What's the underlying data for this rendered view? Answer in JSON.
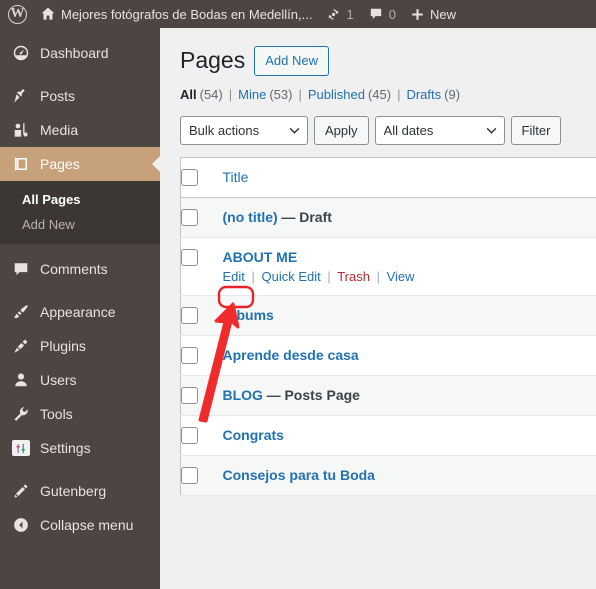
{
  "adminbar": {
    "wp_logo": "wordpress-logo-icon",
    "site_icon": "home-icon",
    "site_name": "Mejores fotógrafos de Bodas en Medellín,...",
    "updates_icon": "updates-icon",
    "updates_count": "1",
    "comments_icon": "comment-bubble-icon",
    "comments_count": "0",
    "new_icon": "plus-icon",
    "new_label": "New"
  },
  "sidebar": {
    "items": [
      {
        "label": "Dashboard",
        "icon": "dashboard-icon",
        "name": "dashboard"
      },
      {
        "label": "Posts",
        "icon": "pin-icon",
        "name": "posts"
      },
      {
        "label": "Media",
        "icon": "media-icon",
        "name": "media"
      },
      {
        "label": "Pages",
        "icon": "pages-icon",
        "name": "pages"
      },
      {
        "label": "Comments",
        "icon": "comment-bubble-icon",
        "name": "comments"
      },
      {
        "label": "Appearance",
        "icon": "paintbrush-icon",
        "name": "appearance"
      },
      {
        "label": "Plugins",
        "icon": "plug-icon",
        "name": "plugins"
      },
      {
        "label": "Users",
        "icon": "user-icon",
        "name": "users"
      },
      {
        "label": "Tools",
        "icon": "wrench-icon",
        "name": "tools"
      },
      {
        "label": "Settings",
        "icon": "sliders-icon",
        "name": "settings"
      },
      {
        "label": "Gutenberg",
        "icon": "pencil-icon",
        "name": "gutenberg"
      },
      {
        "label": "Collapse menu",
        "icon": "collapse-arrow-icon",
        "name": "collapse-menu"
      }
    ],
    "submenu": [
      {
        "label": "All Pages",
        "name": "all-pages"
      },
      {
        "label": "Add New",
        "name": "add-new"
      }
    ],
    "active_item": "Pages",
    "active_submenu": "All Pages",
    "background_color": "#4c4541",
    "active_color": "#c7a17a"
  },
  "main": {
    "heading": "Pages",
    "add_new_label": "Add New",
    "views": [
      {
        "label": "All",
        "count": "(54)",
        "current": true
      },
      {
        "label": "Mine",
        "count": "(53)",
        "current": false
      },
      {
        "label": "Published",
        "count": "(45)",
        "current": false
      },
      {
        "label": "Drafts",
        "count": "(9)",
        "current": false
      }
    ],
    "toolbar": {
      "bulk_actions_value": "Bulk actions",
      "apply_label": "Apply",
      "dates_value": "All dates",
      "filter_label": "Filter"
    },
    "table": {
      "column_header": "Title",
      "rows": [
        {
          "title": "(no title)",
          "state": "— Draft",
          "actions": []
        },
        {
          "title": "ABOUT ME",
          "state": "",
          "actions": [
            "Edit",
            "Quick Edit",
            "Trash",
            "View"
          ]
        },
        {
          "title": "Albums",
          "state": "",
          "actions": []
        },
        {
          "title": "Aprende desde casa",
          "state": "",
          "actions": []
        },
        {
          "title": "BLOG",
          "state": "— Posts Page",
          "actions": []
        },
        {
          "title": "Congrats",
          "state": "",
          "actions": []
        },
        {
          "title": "Consejos para tu Boda",
          "state": "",
          "actions": []
        }
      ]
    }
  },
  "annotation": {
    "highlight_target": "Edit",
    "color": "#e8232a"
  }
}
